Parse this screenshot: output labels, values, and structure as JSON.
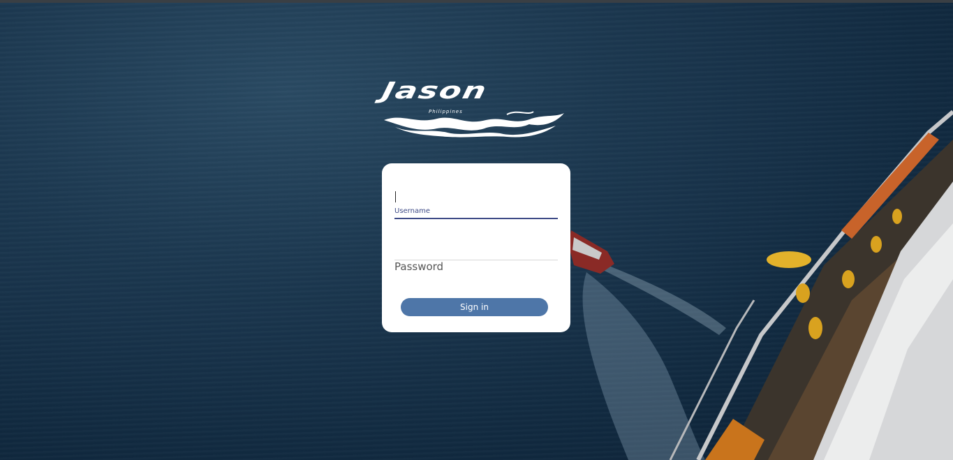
{
  "brand": {
    "name": "Jason",
    "tagline": "Philippines"
  },
  "login": {
    "username_label": "Username",
    "username_value": "",
    "password_label": "Password",
    "password_value": "",
    "submit_label": "Sign in"
  },
  "colors": {
    "primary_button": "#4e76a8",
    "field_underline_active": "#3d4a86",
    "card_background": "#ffffff",
    "page_background": "#112a40"
  },
  "icons": {
    "logo": "jason-waves-logo"
  }
}
